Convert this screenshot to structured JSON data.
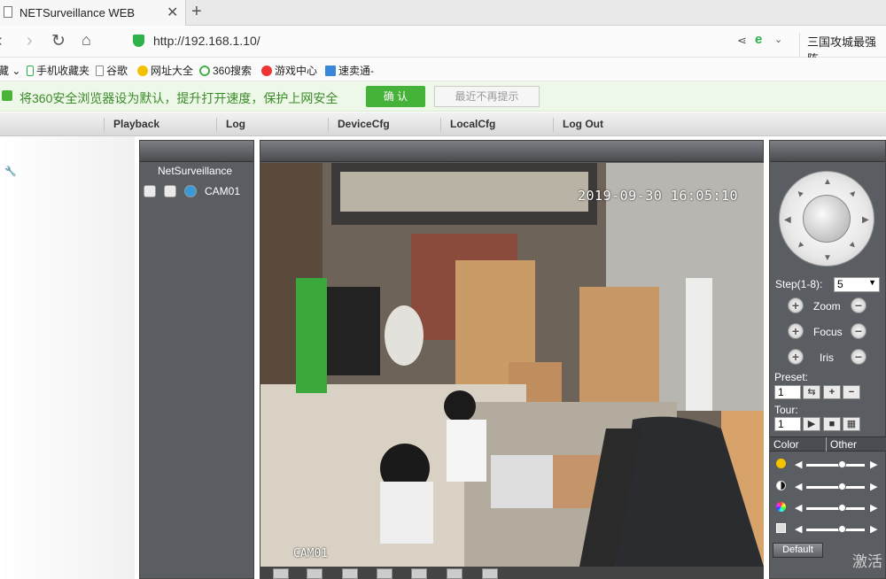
{
  "browser": {
    "tab_title": "NETSurveillance WEB",
    "tab_close": "✕",
    "new_tab": "+",
    "url": "http://192.168.1.10/",
    "search_tail": "三国攻城最强阵",
    "bookmarks": [
      {
        "label": "藏 ⌄"
      },
      {
        "label": "手机收藏夹"
      },
      {
        "label": "谷歌"
      },
      {
        "label": "网址大全"
      },
      {
        "label": "360搜索"
      },
      {
        "label": "游戏中心"
      },
      {
        "label": "速卖通-"
      }
    ],
    "notice": {
      "message": "将360安全浏览器设为默认，提升打开速度，保护上网安全",
      "confirm": "确 认",
      "dismiss": "最近不再提示"
    }
  },
  "app": {
    "menu": [
      "Playback",
      "Log",
      "DeviceCfg",
      "LocalCfg",
      "Log Out"
    ],
    "device_tree": {
      "root": "NetSurveillance",
      "camera": "CAM01"
    },
    "video": {
      "timestamp": "2019-09-30 16:05:10",
      "channel_label": "CAM01"
    },
    "ptz": {
      "step_label": "Step(1-8):",
      "step_value": "5",
      "zoom": "Zoom",
      "focus": "Focus",
      "iris": "Iris",
      "preset_label": "Preset:",
      "preset_value": "1",
      "tour_label": "Tour:",
      "tour_value": "1"
    },
    "color_tabs": [
      "Color",
      "Other"
    ],
    "sliders": [
      {
        "icon": "brightness-icon",
        "level": 0.62
      },
      {
        "icon": "contrast-icon",
        "level": 0.62
      },
      {
        "icon": "saturation-icon",
        "level": 0.62
      },
      {
        "icon": "hue-icon",
        "level": 0.62
      }
    ],
    "default_button": "Default",
    "watermark": "激活"
  },
  "colors": {
    "panel": "#5a5d62",
    "notice_green": "#45b23a",
    "accent_shield": "#2db24a"
  }
}
